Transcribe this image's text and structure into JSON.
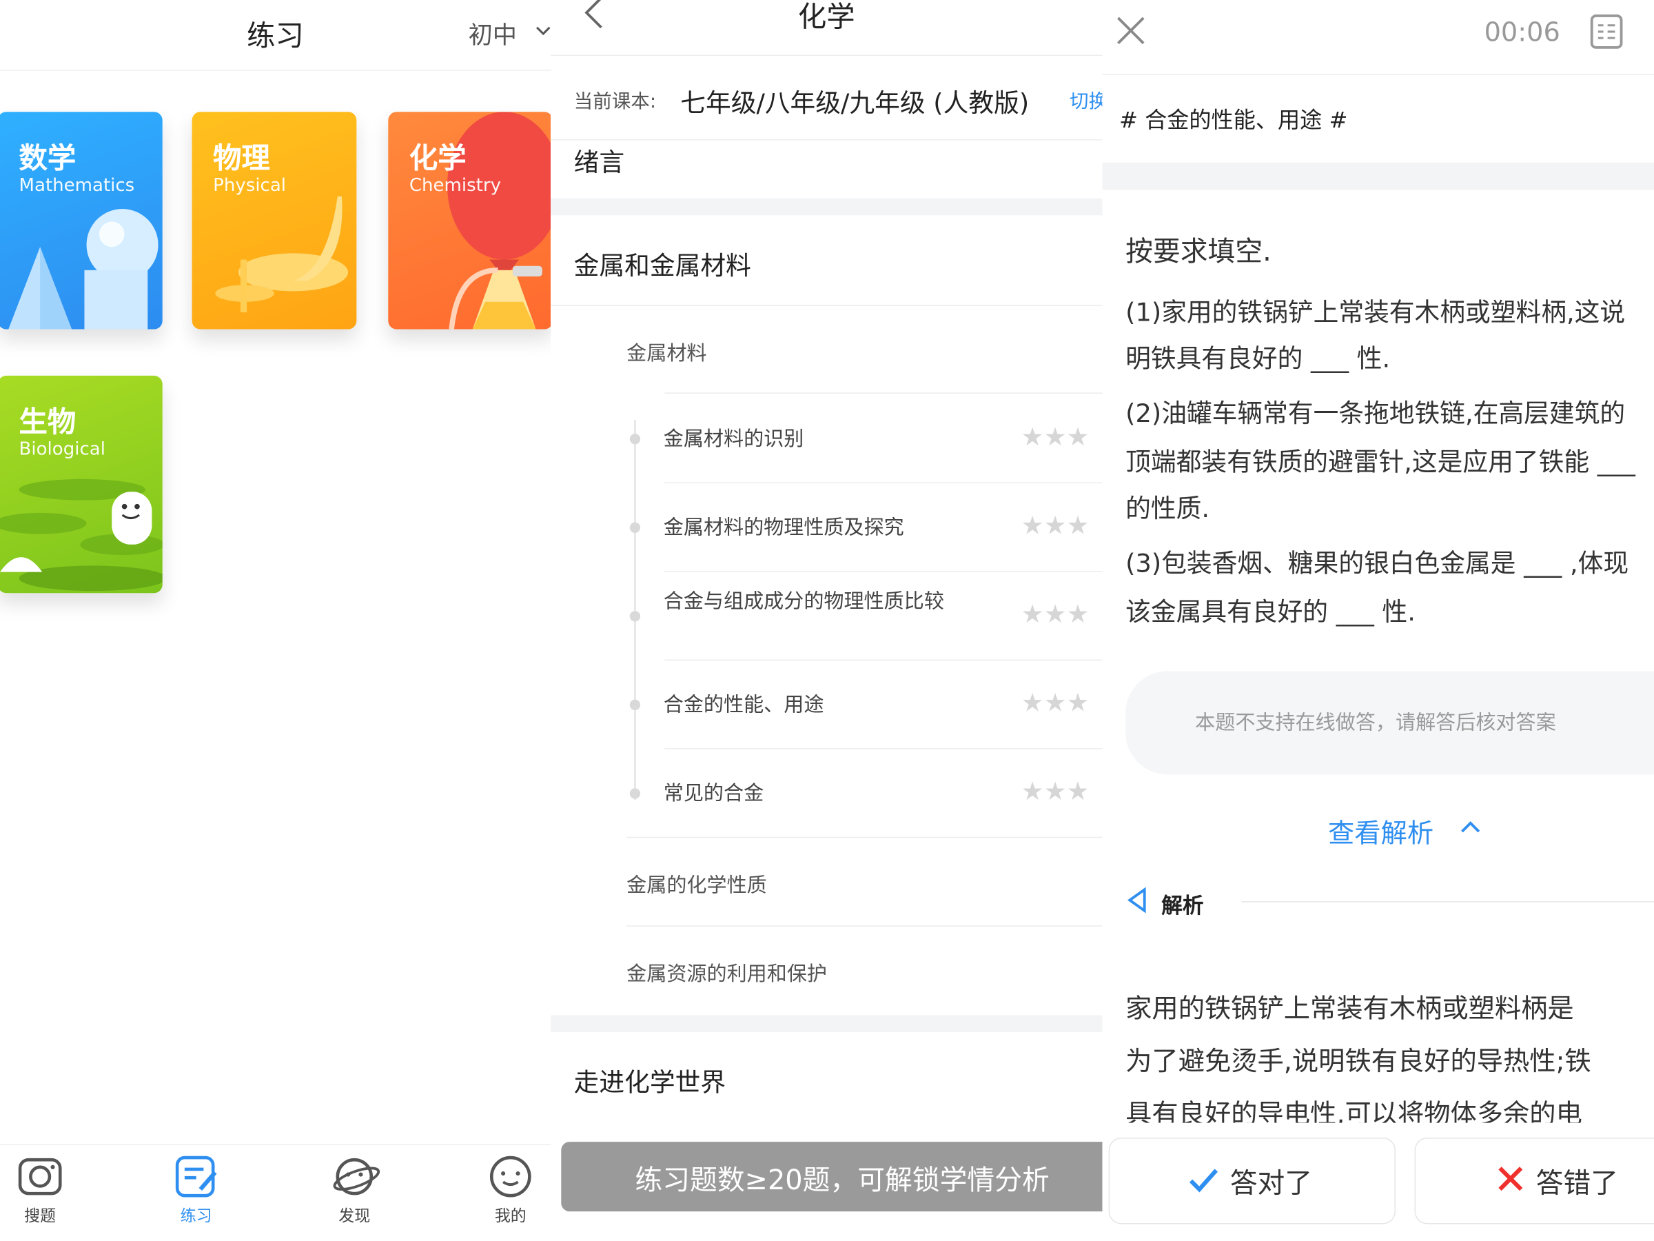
{
  "panel1": {
    "title": "练习",
    "grade": "初中",
    "subjects": [
      {
        "cn": "数学",
        "en": "Mathematics"
      },
      {
        "cn": "物理",
        "en": "Physical"
      },
      {
        "cn": "化学",
        "en": "Chemistry"
      },
      {
        "cn": "生物",
        "en": "Biological"
      }
    ],
    "tabs": [
      {
        "label": "搜题",
        "icon": "camera-icon"
      },
      {
        "label": "练习",
        "icon": "practice-icon",
        "active": true
      },
      {
        "label": "发现",
        "icon": "planet-icon"
      },
      {
        "label": "我的",
        "icon": "face-icon"
      }
    ],
    "colors": {
      "math": "#2d9cf5",
      "physics": "#ffb21a",
      "chemistry": "#ff7a35",
      "biology": "#94d020",
      "accent": "#2f8ff0"
    }
  },
  "panel2": {
    "title": "化学",
    "textbook_label": "当前课本:",
    "textbook": "七年级/八年级/九年级 (人教版)",
    "switch_label": "切换",
    "chapter_intro": "绪言",
    "chapter_metals": "金属和金属材料",
    "section_materials": "金属材料",
    "points": [
      "金属材料的识别",
      "金属材料的物理性质及探究",
      "合金与组成成分的物理性质比较",
      "合金的性能、用途",
      "常见的合金"
    ],
    "section_chem": "金属的化学性质",
    "section_resources": "金属资源的利用和保护",
    "chapter_world": "走进化学世界",
    "stars": "★★★",
    "banner": "练习题数≥20题，可解锁学情分析"
  },
  "panel3": {
    "timer": "00:06",
    "topic": "# 合金的性能、用途 #",
    "question_lines": [
      "按要求填空.",
      "(1)家用的铁锅铲上常装有木柄或塑料柄,这说",
      "明铁具有良好的 ___ 性.",
      "(2)油罐车辆常有一条拖地铁链,在高层建筑的",
      "顶端都装有铁质的避雷针,这是应用了铁能 ___",
      "的性质.",
      "(3)包装香烟、糖果的银白色金属是 ___ ,体现",
      "该金属具有良好的 ___ 性."
    ],
    "notice": "本题不支持在线做答，请解答后核对答案",
    "see_analysis": "查看解析",
    "analysis_title": "解析",
    "analysis_lines": [
      "家用的铁锅铲上常装有木柄或塑料柄是",
      "为了避免烫手,说明铁有良好的导热性;铁",
      "具有良好的导电性,可以将物体多余的电"
    ],
    "correct_label": "答对了",
    "wrong_label": "答错了",
    "colors": {
      "correct": "#2f8ff0",
      "wrong": "#f0302c"
    }
  }
}
